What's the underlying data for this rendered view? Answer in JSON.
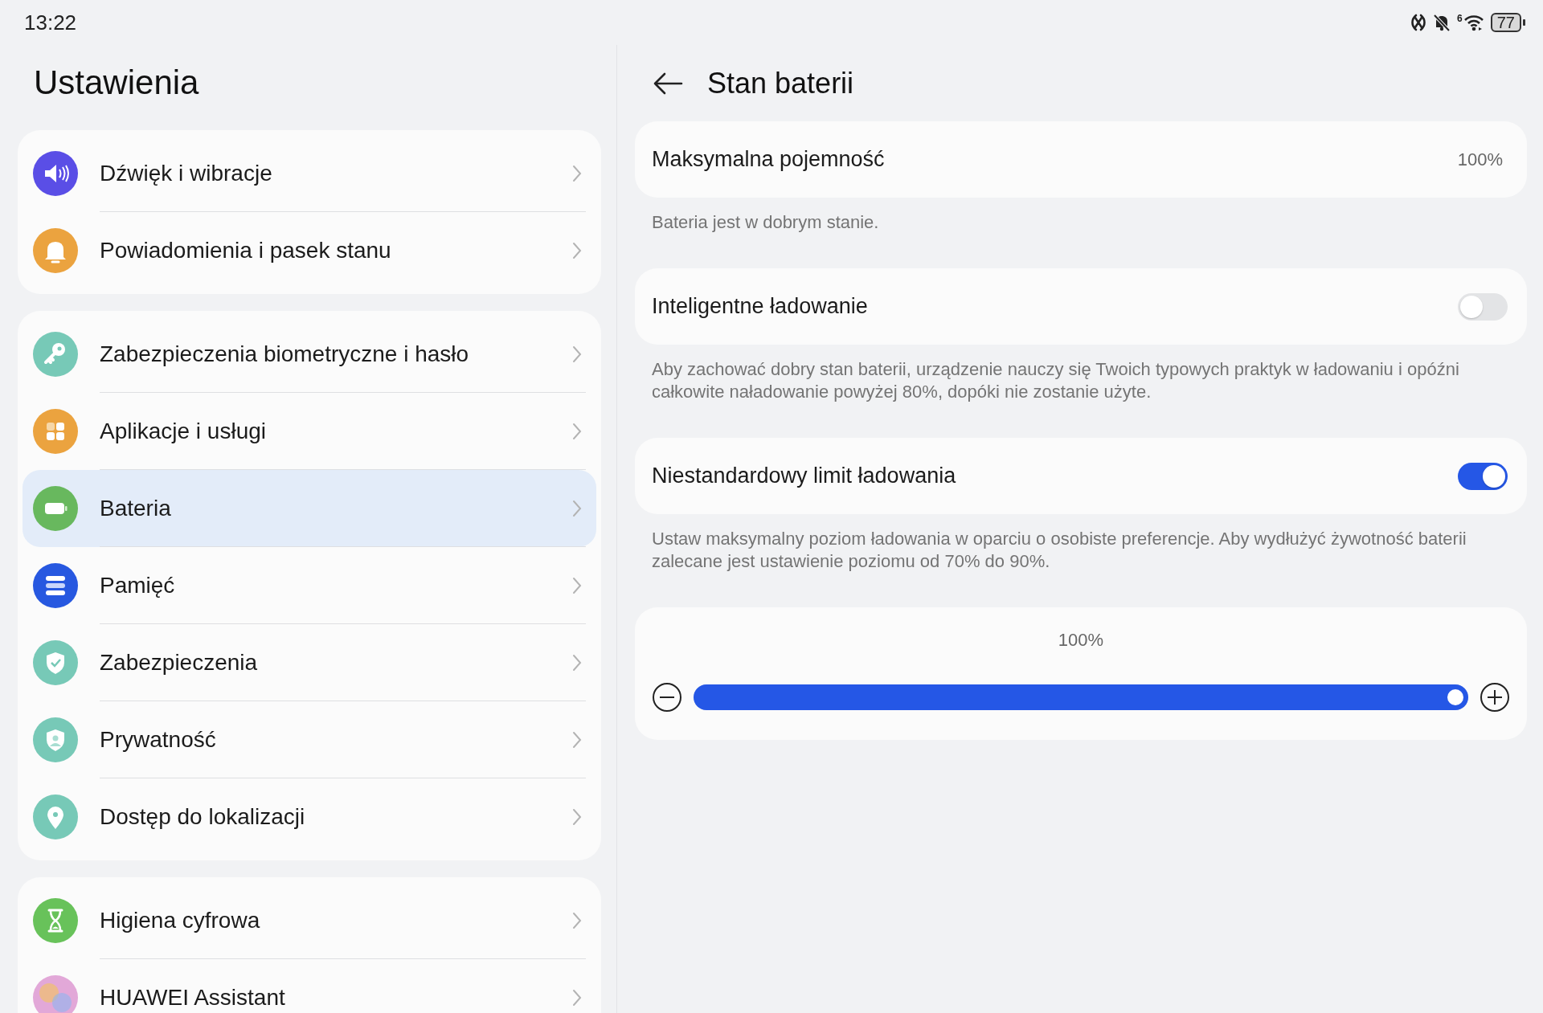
{
  "status_bar": {
    "time": "13:22",
    "wifi_badge": "6",
    "battery": "77"
  },
  "sidebar": {
    "title": "Ustawienia",
    "groups": [
      {
        "items": [
          {
            "label": "Dźwięk i wibracje",
            "color": "#5a4ee6",
            "selected": false
          },
          {
            "label": "Powiadomienia i pasek stanu",
            "color": "#eba33f",
            "selected": false
          }
        ]
      },
      {
        "items": [
          {
            "label": "Zabezpieczenia biometryczne i hasło",
            "color": "#77c9b7",
            "selected": false
          },
          {
            "label": "Aplikacje i usługi",
            "color": "#eba33f",
            "selected": false
          },
          {
            "label": "Bateria",
            "color": "#68b85e",
            "selected": true
          },
          {
            "label": "Pamięć",
            "color": "#2758e0",
            "selected": false
          },
          {
            "label": "Zabezpieczenia",
            "color": "#77c9b7",
            "selected": false
          },
          {
            "label": "Prywatność",
            "color": "#77c9b7",
            "selected": false
          },
          {
            "label": "Dostęp do lokalizacji",
            "color": "#77c9b7",
            "selected": false
          }
        ]
      },
      {
        "items": [
          {
            "label": "Higiena cyfrowa",
            "color": "#68c25a",
            "selected": false
          },
          {
            "label": "HUAWEI Assistant",
            "color": "#e2a8d8",
            "selected": false
          }
        ]
      }
    ]
  },
  "detail": {
    "title": "Stan baterii",
    "sections": [
      {
        "kind": "value",
        "label": "Maksymalna pojemność",
        "value": "100%",
        "caption": "Bateria jest w dobrym stanie."
      },
      {
        "kind": "toggle",
        "label": "Inteligentne ładowanie",
        "on": false,
        "caption": "Aby zachować dobry stan baterii, urządzenie nauczy się Twoich typowych praktyk w ładowaniu i opóźni całkowite naładowanie powyżej 80%, dopóki nie zostanie użyte."
      },
      {
        "kind": "toggle",
        "label": "Niestandardowy limit ładowania",
        "on": true,
        "caption": "Ustaw maksymalny poziom ładowania w oparciu o osobiste preferencje. Aby wydłużyć żywotność baterii zalecane jest ustawienie poziomu od 70% do 90%."
      },
      {
        "kind": "slider",
        "reading": "100%",
        "level": 1.0
      }
    ]
  }
}
